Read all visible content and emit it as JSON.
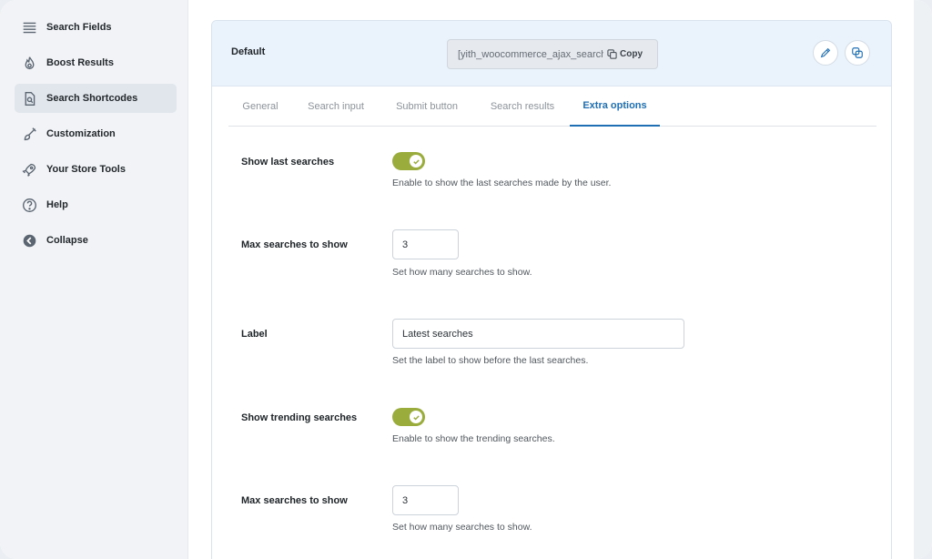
{
  "sidebar": {
    "items": [
      {
        "label": "Search Fields",
        "icon": "list-icon"
      },
      {
        "label": "Boost Results",
        "icon": "fire-icon"
      },
      {
        "label": "Search Shortcodes",
        "icon": "document-search-icon",
        "active": true
      },
      {
        "label": "Customization",
        "icon": "brush-icon"
      },
      {
        "label": "Your Store Tools",
        "icon": "rocket-icon"
      },
      {
        "label": "Help",
        "icon": "help-icon"
      },
      {
        "label": "Collapse",
        "icon": "collapse-icon"
      }
    ]
  },
  "panel": {
    "title": "Default",
    "shortcode": "[yith_woocommerce_ajax_search preset=\"default\"]",
    "copy_label": "Copy"
  },
  "tabs": [
    {
      "label": "General"
    },
    {
      "label": "Search input"
    },
    {
      "label": "Submit button"
    },
    {
      "label": "Search results"
    },
    {
      "label": "Extra options",
      "active": true
    }
  ],
  "fields": {
    "show_last": {
      "label": "Show last searches",
      "desc": "Enable to show the last searches made by the user.",
      "enabled": true
    },
    "max_last": {
      "label": "Max searches to show",
      "value": "3",
      "desc": "Set how many searches to show."
    },
    "label": {
      "label": "Label",
      "value": "Latest searches",
      "desc": "Set the label to show before the last searches."
    },
    "show_trending": {
      "label": "Show trending searches",
      "desc": "Enable to show the trending searches.",
      "enabled": true
    },
    "max_trending": {
      "label": "Max searches to show",
      "value": "3",
      "desc": "Set how many searches to show."
    }
  },
  "colors": {
    "accent": "#1f6fb5",
    "toggle_on": "#9aac3b",
    "header_bg": "#eaf2fb"
  }
}
